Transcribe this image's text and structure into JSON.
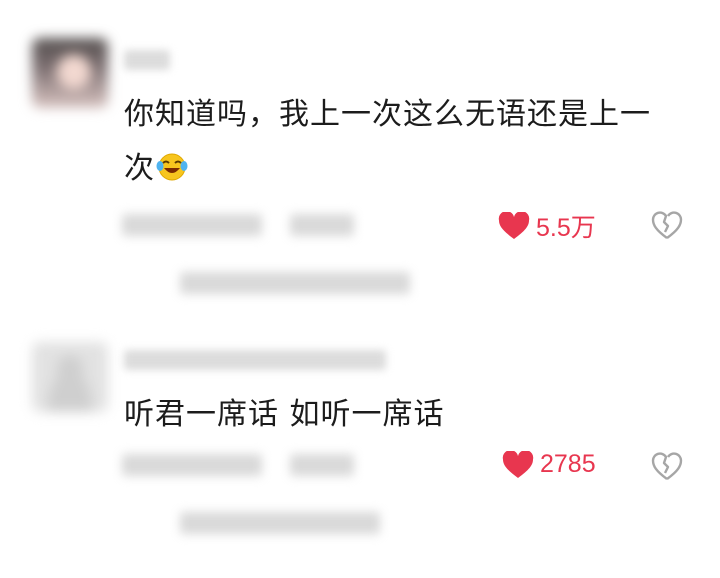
{
  "comments": [
    {
      "text": "你知道吗，我上一次这么无语还是上一次",
      "emoji": "crying-laughing-emoji",
      "likes": "5.5万"
    },
    {
      "text": "听君一席话 如听一席话",
      "likes": "2785"
    }
  ],
  "colors": {
    "like": "#e8364f",
    "text": "#1c1c1c",
    "icon": "#a6a6a6"
  }
}
